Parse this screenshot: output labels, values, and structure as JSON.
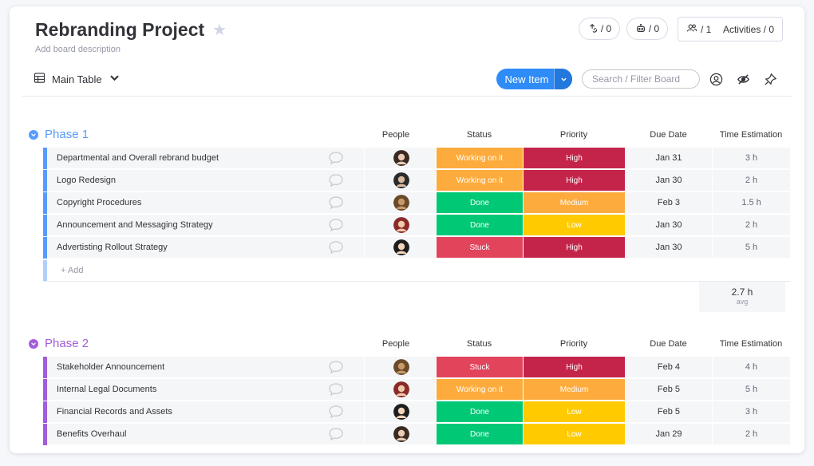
{
  "board": {
    "title": "Rebranding Project",
    "description": "Add board description"
  },
  "header": {
    "integrations_count": "/ 0",
    "automations_count": "/ 0",
    "members_count": "/ 1",
    "activities_label": "Activities / 0"
  },
  "toolbar": {
    "view_label": "Main Table",
    "new_item_label": "New Item",
    "search_placeholder": "Search / Filter Board"
  },
  "columns": {
    "people": "People",
    "status": "Status",
    "priority": "Priority",
    "due_date": "Due Date",
    "time_estimation": "Time Estimation"
  },
  "colors": {
    "phase1": "#579bfc",
    "phase2": "#a25ddc",
    "working_on_it": "#fdab3d",
    "done": "#00c875",
    "stuck": "#e2445c",
    "high": "#c4244a",
    "medium": "#fdab3d",
    "low": "#ffcb00"
  },
  "groups": [
    {
      "name": "Phase 1",
      "color": "#579bfc",
      "rows": [
        {
          "name": "Departmental and Overall rebrand budget",
          "status": "Working on it",
          "priority": "High",
          "due": "Jan 31",
          "estimate": "3 h"
        },
        {
          "name": "Logo Redesign",
          "status": "Working on it",
          "priority": "High",
          "due": "Jan 30",
          "estimate": "2 h"
        },
        {
          "name": "Copyright Procedures",
          "status": "Done",
          "priority": "Medium",
          "due": "Feb 3",
          "estimate": "1.5 h"
        },
        {
          "name": "Announcement and Messaging Strategy",
          "status": "Done",
          "priority": "Low",
          "due": "Jan 30",
          "estimate": "2 h"
        },
        {
          "name": "Advertisting Rollout Strategy",
          "status": "Stuck",
          "priority": "High",
          "due": "Jan 30",
          "estimate": "5 h"
        }
      ],
      "add_label": "+ Add",
      "summary_value": "2.7 h",
      "summary_unit": "avg"
    },
    {
      "name": "Phase 2",
      "color": "#a25ddc",
      "rows": [
        {
          "name": "Stakeholder Announcement",
          "status": "Stuck",
          "priority": "High",
          "due": "Feb 4",
          "estimate": "4 h"
        },
        {
          "name": "Internal Legal Documents",
          "status": "Working on it",
          "priority": "Medium",
          "due": "Feb 5",
          "estimate": "5 h"
        },
        {
          "name": "Financial Records and Assets",
          "status": "Done",
          "priority": "Low",
          "due": "Feb 5",
          "estimate": "3 h"
        },
        {
          "name": "Benefits Overhaul",
          "status": "Done",
          "priority": "Low",
          "due": "Jan 29",
          "estimate": "2 h"
        }
      ]
    }
  ]
}
